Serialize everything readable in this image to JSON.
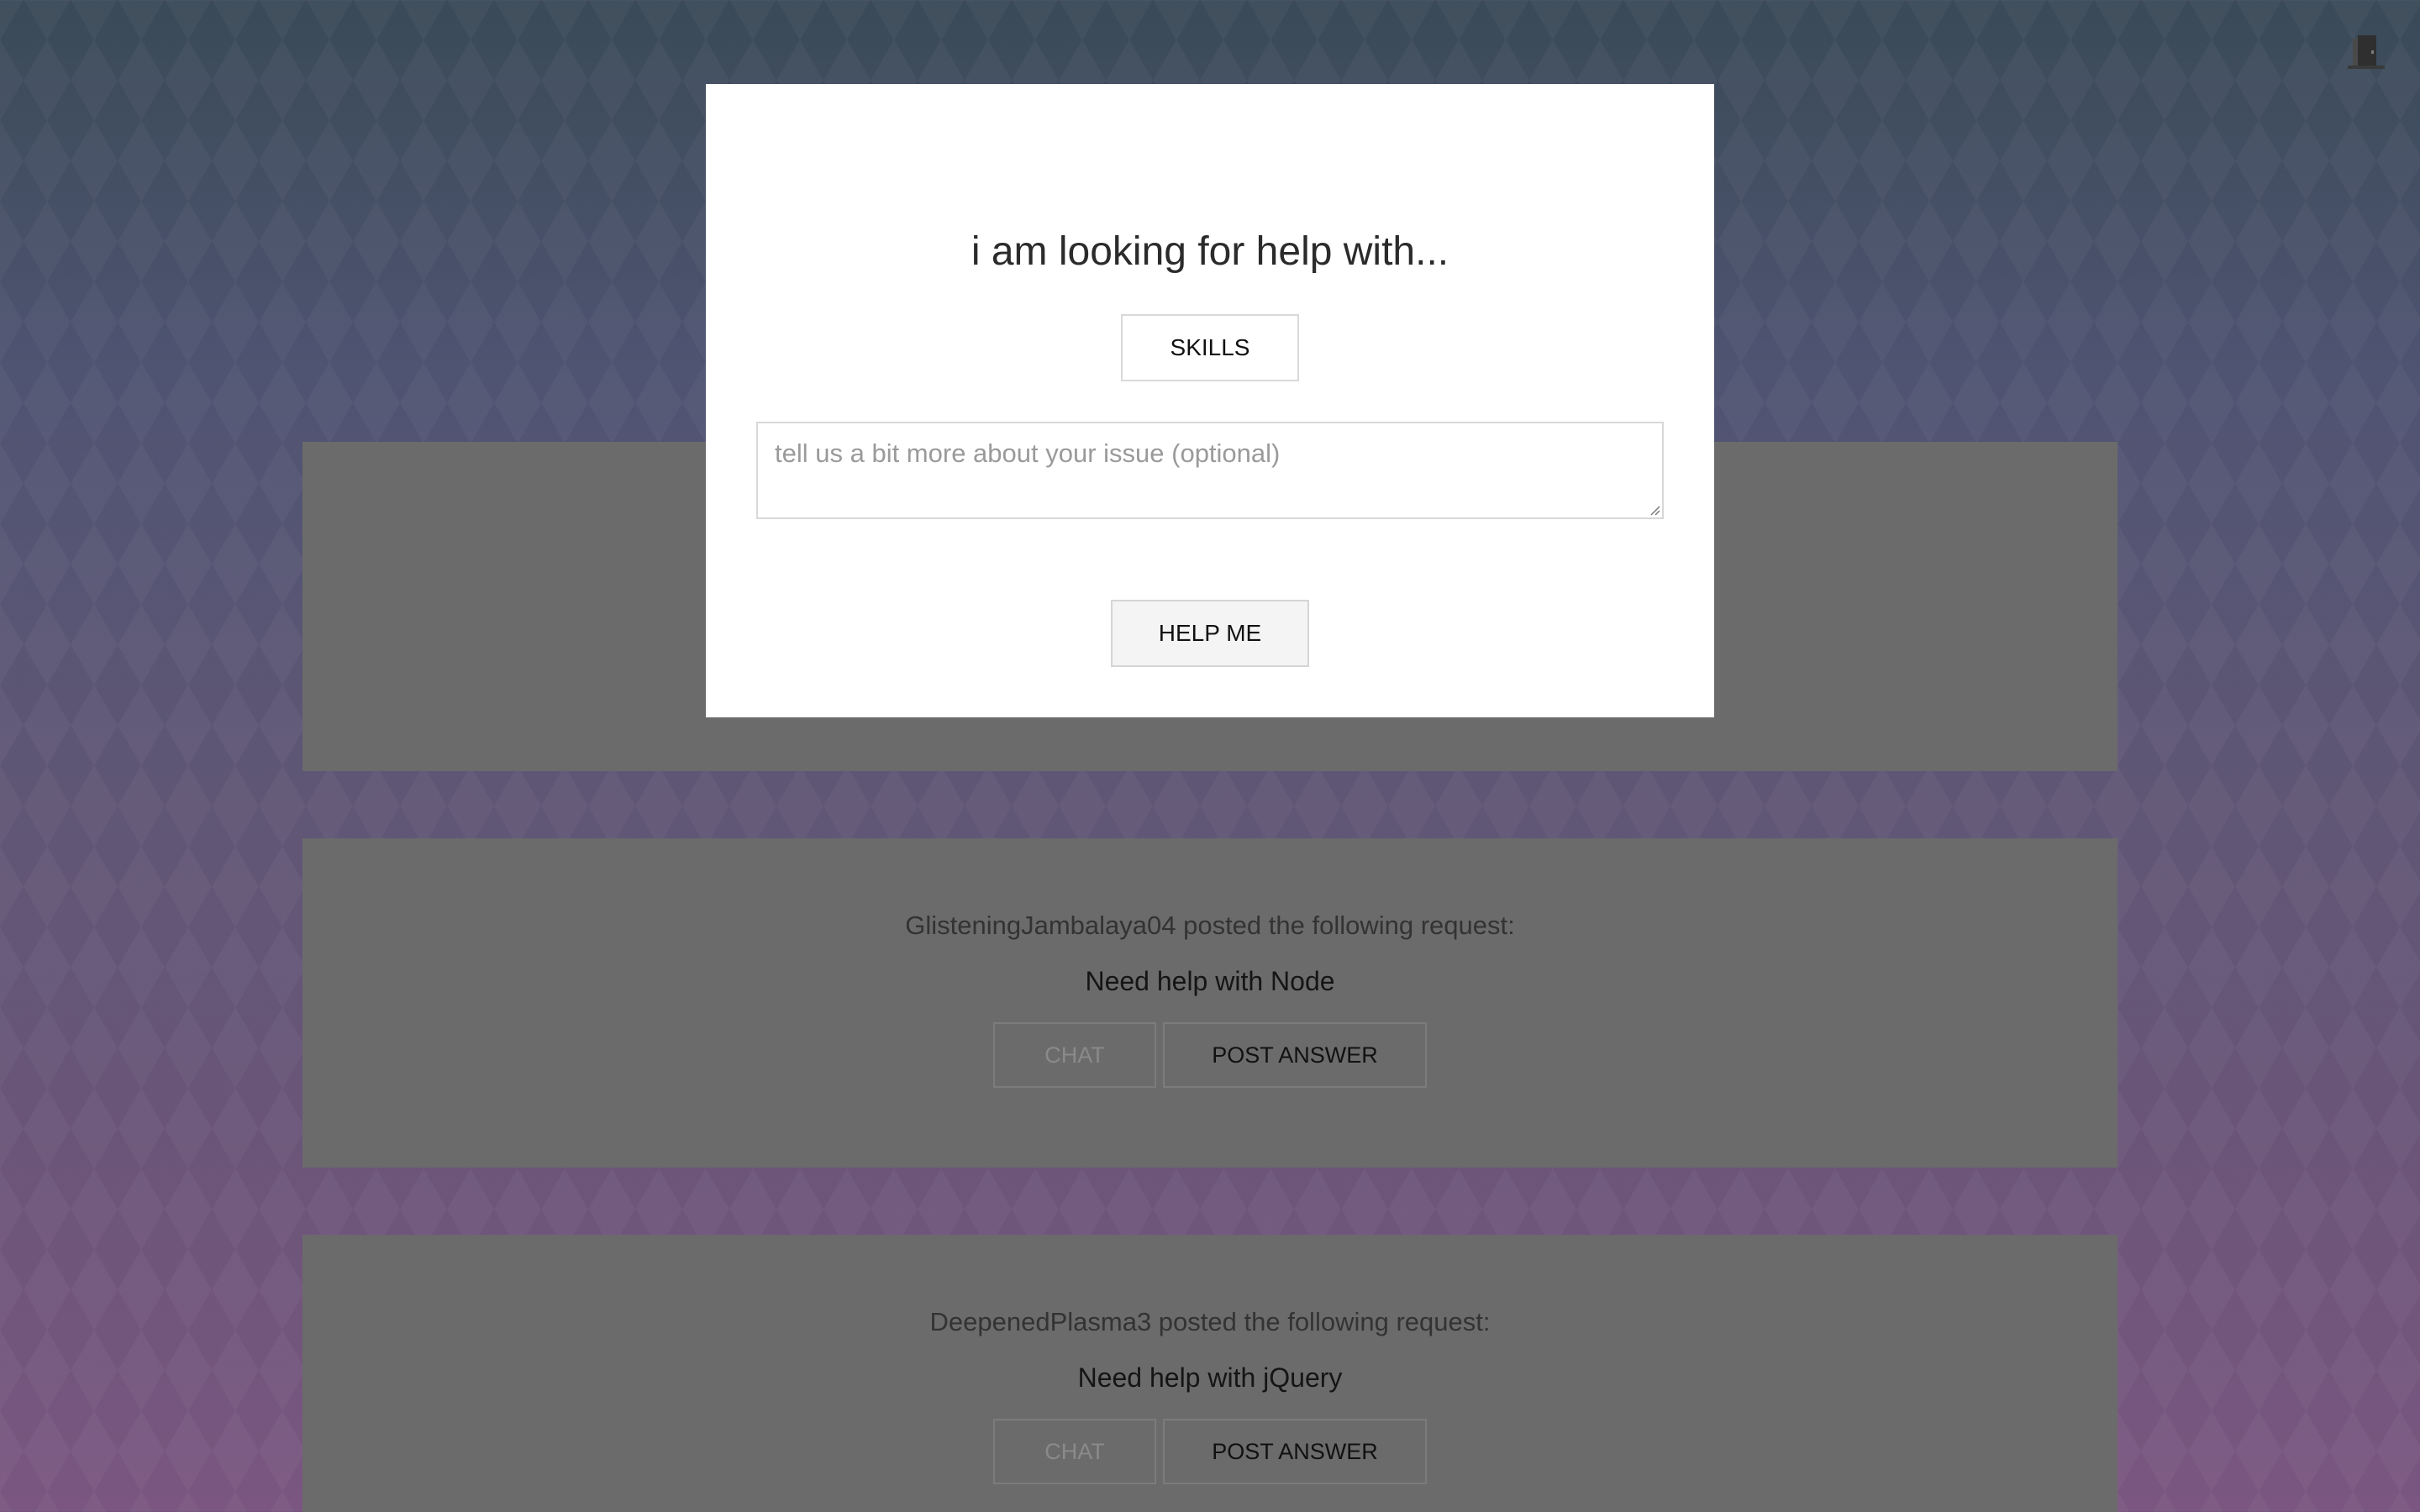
{
  "header": {
    "logout_icon": "door-exit-icon"
  },
  "modal": {
    "title": "i am looking for help with...",
    "skills_label": "SKILLS",
    "issue_placeholder": "tell us a bit more about your issue (optional)",
    "issue_value": "",
    "help_label": "HELP ME"
  },
  "requests": [
    {
      "poster": "",
      "request": "",
      "chat_label": "",
      "answer_label": ""
    },
    {
      "poster": "GlisteningJambalaya04 posted the following request:",
      "request": "Need help with Node",
      "chat_label": "CHAT",
      "answer_label": "POST ANSWER"
    },
    {
      "poster": "DeepenedPlasma3 posted the following request:",
      "request": "Need help with jQuery",
      "chat_label": "CHAT",
      "answer_label": "POST ANSWER"
    }
  ],
  "colors": {
    "background_top": "#3a4a57",
    "background_bottom": "#7a5680",
    "card": "#6b6b6b",
    "modal": "#ffffff"
  }
}
